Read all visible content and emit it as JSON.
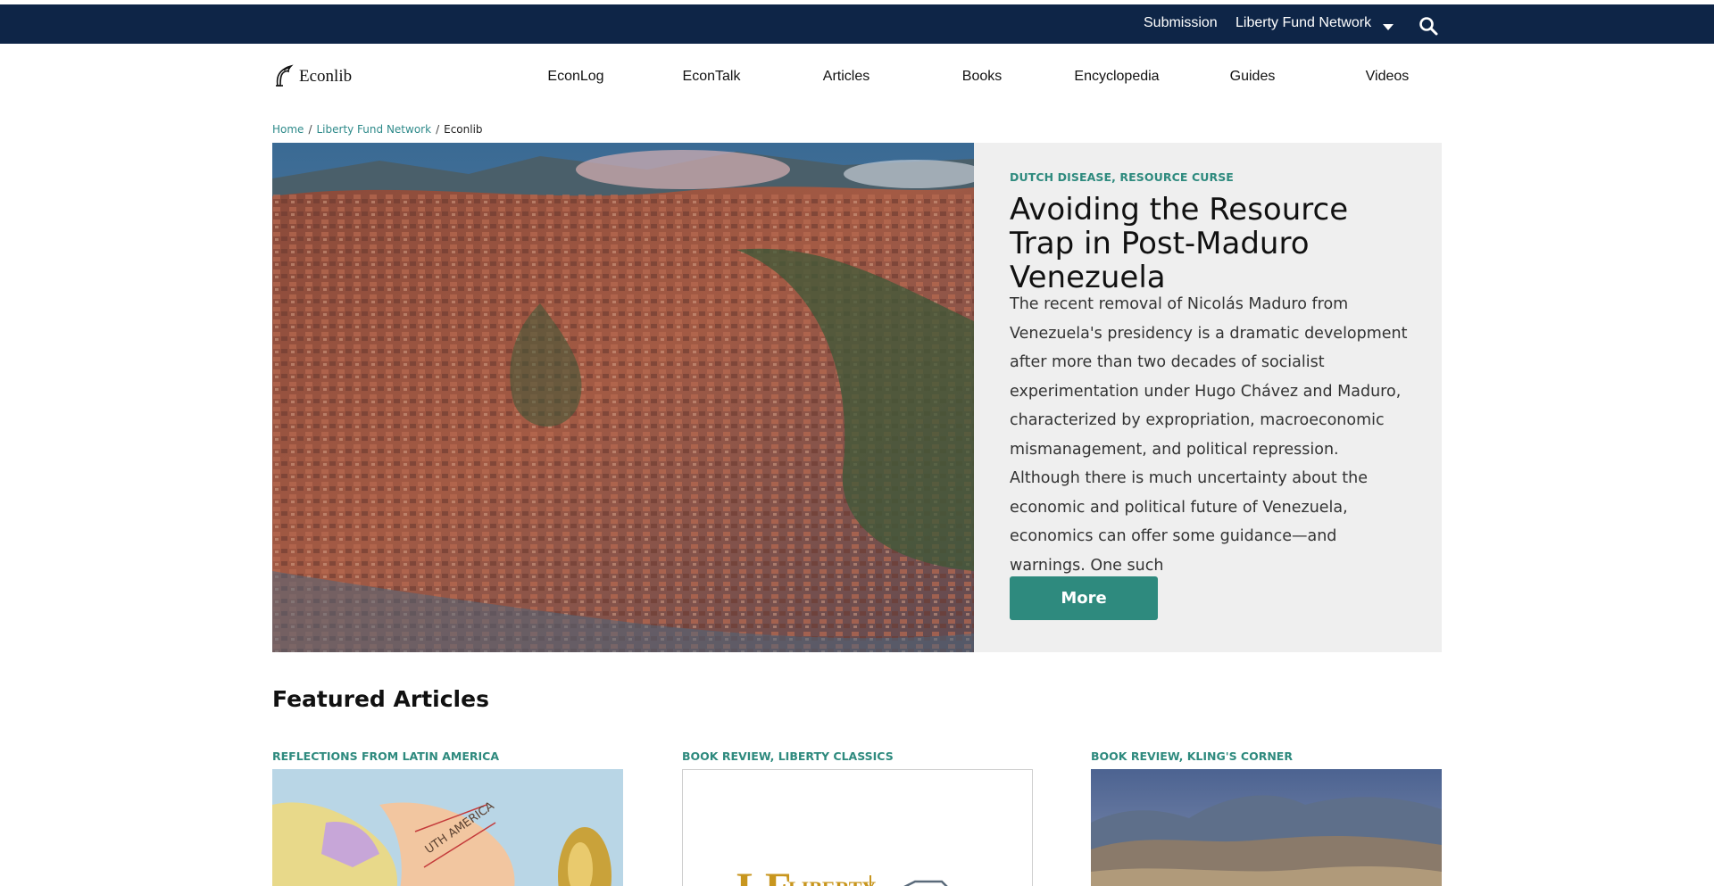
{
  "topbar": {
    "submission": "Submission",
    "network": "Liberty Fund Network",
    "search_icon": "search-icon",
    "background": "#0e2547"
  },
  "logo": {
    "text": "Econlib"
  },
  "nav": {
    "items": [
      "EconLog",
      "EconTalk",
      "Articles",
      "Books",
      "Encyclopedia",
      "Guides",
      "Videos"
    ]
  },
  "breadcrumb": {
    "home": "Home",
    "network": "Liberty Fund Network",
    "current": "Econlib"
  },
  "hero": {
    "tags": "DUTCH DISEASE, RESOURCE CURSE",
    "title": "Avoiding the Resource Trap in Post-Maduro Venezuela",
    "excerpt": "The recent removal of Nicolás Maduro from Venezuela's presidency is a dramatic development after more than two decades of socialist experimentation under Hugo Chávez and Maduro, characterized by expropriation, macroeconomic mismanagement, and political repression.  Although there is much uncertainty about the economic and political future of Venezuela, economics can offer some guidance—and warnings. One such",
    "more_label": "More"
  },
  "featured": {
    "title": "Featured Articles",
    "cards": [
      {
        "tags": "REFLECTIONS FROM LATIN AMERICA"
      },
      {
        "tags": "BOOK REVIEW, LIBERTY CLASSICS"
      },
      {
        "tags": "BOOK REVIEW, KLING'S CORNER"
      }
    ]
  },
  "colors": {
    "accent": "#2e8a7e",
    "link": "#2e8a8a",
    "panel": "#efefef"
  }
}
